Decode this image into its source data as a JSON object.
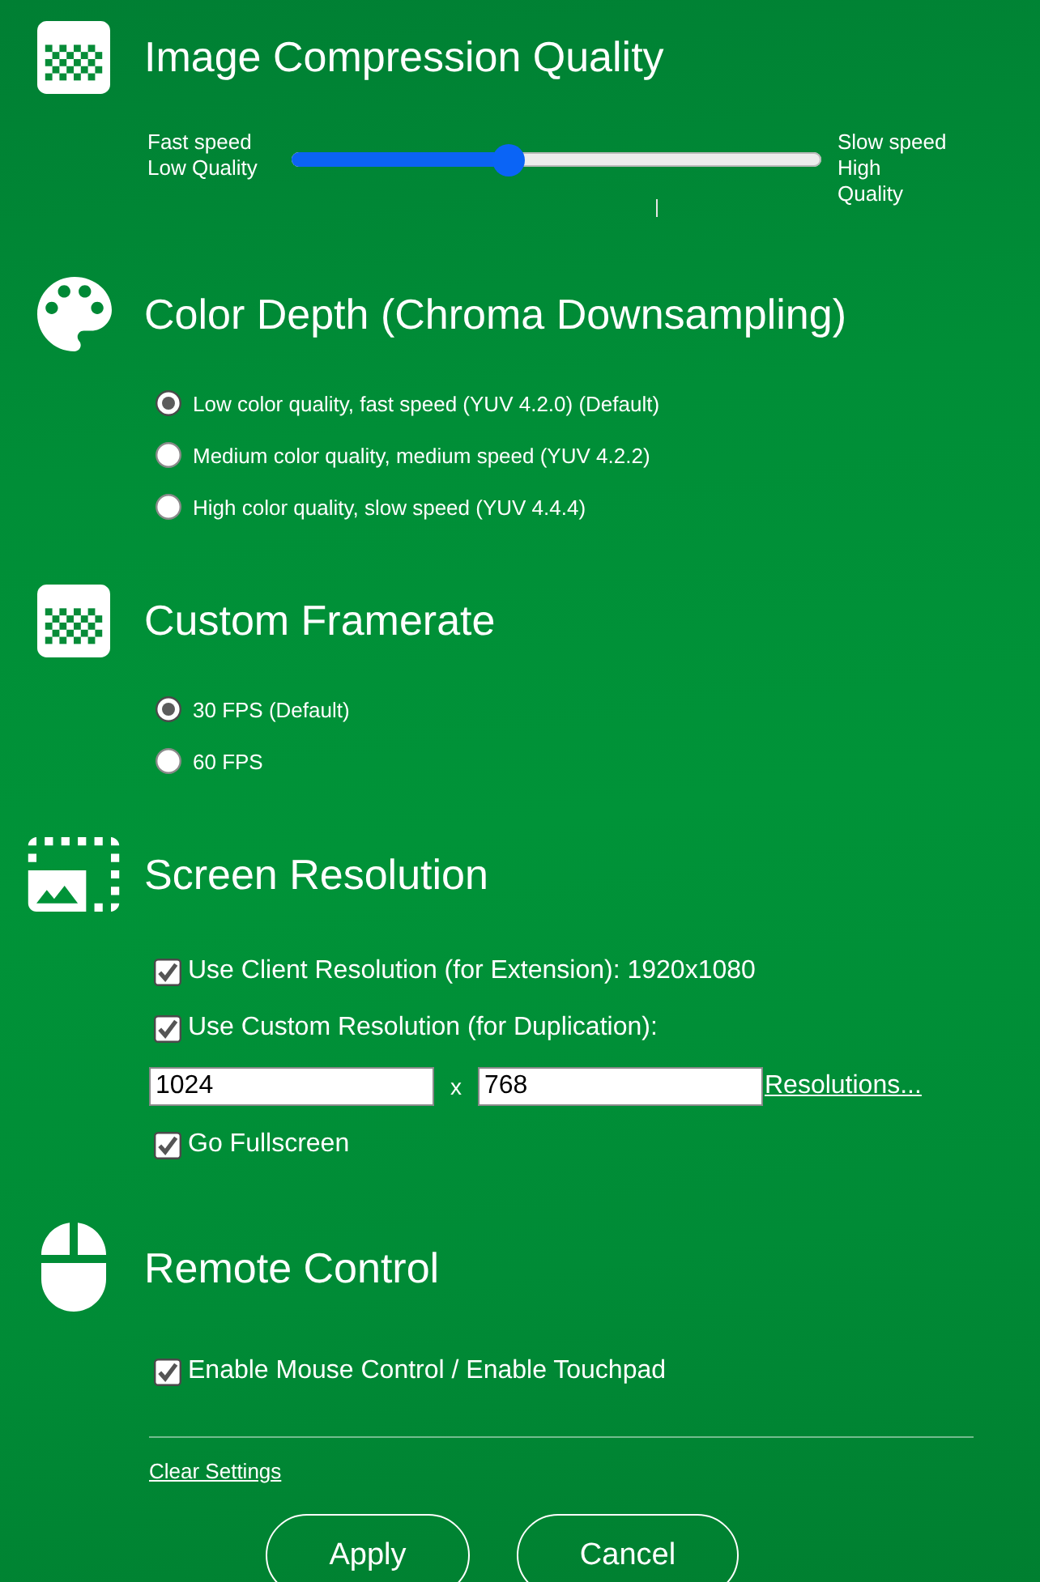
{
  "sections": [
    {
      "kind": "slider",
      "title": "Image Compression Quality",
      "left_label": "Fast speed\nLow Quality",
      "right_label": "Slow speed\nHigh\nQuality",
      "level": 0.41
    },
    {
      "kind": "radio",
      "title": "Color Depth (Chroma Downsampling)",
      "options": [
        {
          "label": "Low color quality, fast speed (YUV 4.2.0) (Default)",
          "selected": true
        },
        {
          "label": "Medium color quality, medium speed (YUV 4.2.2)",
          "selected": false
        },
        {
          "label": "High color quality, slow speed (YUV 4.4.4)",
          "selected": false
        }
      ]
    },
    {
      "kind": "radio",
      "title": "Custom Framerate",
      "options": [
        {
          "label": "30 FPS (Default)",
          "selected": true
        },
        {
          "label": "60 FPS",
          "selected": false
        }
      ]
    },
    {
      "kind": "checks",
      "title": "Screen Resolution",
      "items": [
        {
          "kind": "checkbox",
          "label": "Use Client Resolution (for Extension): 1920x1080",
          "checked": true
        },
        {
          "kind": "checkbox",
          "label": "Use Custom Resolution (for Duplication):",
          "checked": true
        },
        {
          "kind": "size",
          "fields": [
            {
              "value": "1024"
            },
            {
              "value": "768"
            }
          ],
          "separator": "x",
          "link": "Resolutions..."
        },
        {
          "kind": "checkbox",
          "label": "Go Fullscreen",
          "checked": true
        }
      ]
    },
    {
      "kind": "checks",
      "title": "Remote Control",
      "items": [
        {
          "kind": "checkbox",
          "label": "Enable Mouse Control / Enable Touchpad",
          "checked": true
        }
      ]
    }
  ],
  "footer": {
    "link": "Clear Settings",
    "buttons": [
      {
        "label": "Apply"
      },
      {
        "label": "Cancel"
      }
    ]
  }
}
